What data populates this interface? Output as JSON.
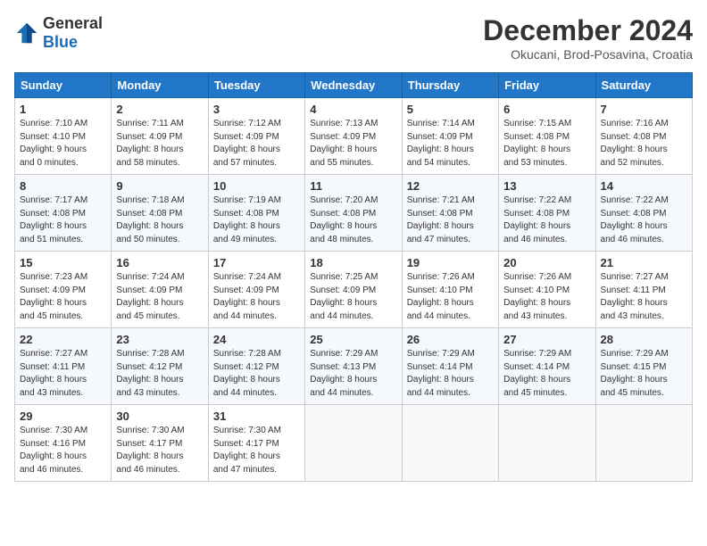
{
  "header": {
    "logo_general": "General",
    "logo_blue": "Blue",
    "month_title": "December 2024",
    "location": "Okucani, Brod-Posavina, Croatia"
  },
  "weekdays": [
    "Sunday",
    "Monday",
    "Tuesday",
    "Wednesday",
    "Thursday",
    "Friday",
    "Saturday"
  ],
  "weeks": [
    [
      {
        "day": "1",
        "sunrise": "Sunrise: 7:10 AM",
        "sunset": "Sunset: 4:10 PM",
        "daylight": "Daylight: 9 hours and 0 minutes."
      },
      {
        "day": "2",
        "sunrise": "Sunrise: 7:11 AM",
        "sunset": "Sunset: 4:09 PM",
        "daylight": "Daylight: 8 hours and 58 minutes."
      },
      {
        "day": "3",
        "sunrise": "Sunrise: 7:12 AM",
        "sunset": "Sunset: 4:09 PM",
        "daylight": "Daylight: 8 hours and 57 minutes."
      },
      {
        "day": "4",
        "sunrise": "Sunrise: 7:13 AM",
        "sunset": "Sunset: 4:09 PM",
        "daylight": "Daylight: 8 hours and 55 minutes."
      },
      {
        "day": "5",
        "sunrise": "Sunrise: 7:14 AM",
        "sunset": "Sunset: 4:09 PM",
        "daylight": "Daylight: 8 hours and 54 minutes."
      },
      {
        "day": "6",
        "sunrise": "Sunrise: 7:15 AM",
        "sunset": "Sunset: 4:08 PM",
        "daylight": "Daylight: 8 hours and 53 minutes."
      },
      {
        "day": "7",
        "sunrise": "Sunrise: 7:16 AM",
        "sunset": "Sunset: 4:08 PM",
        "daylight": "Daylight: 8 hours and 52 minutes."
      }
    ],
    [
      {
        "day": "8",
        "sunrise": "Sunrise: 7:17 AM",
        "sunset": "Sunset: 4:08 PM",
        "daylight": "Daylight: 8 hours and 51 minutes."
      },
      {
        "day": "9",
        "sunrise": "Sunrise: 7:18 AM",
        "sunset": "Sunset: 4:08 PM",
        "daylight": "Daylight: 8 hours and 50 minutes."
      },
      {
        "day": "10",
        "sunrise": "Sunrise: 7:19 AM",
        "sunset": "Sunset: 4:08 PM",
        "daylight": "Daylight: 8 hours and 49 minutes."
      },
      {
        "day": "11",
        "sunrise": "Sunrise: 7:20 AM",
        "sunset": "Sunset: 4:08 PM",
        "daylight": "Daylight: 8 hours and 48 minutes."
      },
      {
        "day": "12",
        "sunrise": "Sunrise: 7:21 AM",
        "sunset": "Sunset: 4:08 PM",
        "daylight": "Daylight: 8 hours and 47 minutes."
      },
      {
        "day": "13",
        "sunrise": "Sunrise: 7:22 AM",
        "sunset": "Sunset: 4:08 PM",
        "daylight": "Daylight: 8 hours and 46 minutes."
      },
      {
        "day": "14",
        "sunrise": "Sunrise: 7:22 AM",
        "sunset": "Sunset: 4:08 PM",
        "daylight": "Daylight: 8 hours and 46 minutes."
      }
    ],
    [
      {
        "day": "15",
        "sunrise": "Sunrise: 7:23 AM",
        "sunset": "Sunset: 4:09 PM",
        "daylight": "Daylight: 8 hours and 45 minutes."
      },
      {
        "day": "16",
        "sunrise": "Sunrise: 7:24 AM",
        "sunset": "Sunset: 4:09 PM",
        "daylight": "Daylight: 8 hours and 45 minutes."
      },
      {
        "day": "17",
        "sunrise": "Sunrise: 7:24 AM",
        "sunset": "Sunset: 4:09 PM",
        "daylight": "Daylight: 8 hours and 44 minutes."
      },
      {
        "day": "18",
        "sunrise": "Sunrise: 7:25 AM",
        "sunset": "Sunset: 4:09 PM",
        "daylight": "Daylight: 8 hours and 44 minutes."
      },
      {
        "day": "19",
        "sunrise": "Sunrise: 7:26 AM",
        "sunset": "Sunset: 4:10 PM",
        "daylight": "Daylight: 8 hours and 44 minutes."
      },
      {
        "day": "20",
        "sunrise": "Sunrise: 7:26 AM",
        "sunset": "Sunset: 4:10 PM",
        "daylight": "Daylight: 8 hours and 43 minutes."
      },
      {
        "day": "21",
        "sunrise": "Sunrise: 7:27 AM",
        "sunset": "Sunset: 4:11 PM",
        "daylight": "Daylight: 8 hours and 43 minutes."
      }
    ],
    [
      {
        "day": "22",
        "sunrise": "Sunrise: 7:27 AM",
        "sunset": "Sunset: 4:11 PM",
        "daylight": "Daylight: 8 hours and 43 minutes."
      },
      {
        "day": "23",
        "sunrise": "Sunrise: 7:28 AM",
        "sunset": "Sunset: 4:12 PM",
        "daylight": "Daylight: 8 hours and 43 minutes."
      },
      {
        "day": "24",
        "sunrise": "Sunrise: 7:28 AM",
        "sunset": "Sunset: 4:12 PM",
        "daylight": "Daylight: 8 hours and 44 minutes."
      },
      {
        "day": "25",
        "sunrise": "Sunrise: 7:29 AM",
        "sunset": "Sunset: 4:13 PM",
        "daylight": "Daylight: 8 hours and 44 minutes."
      },
      {
        "day": "26",
        "sunrise": "Sunrise: 7:29 AM",
        "sunset": "Sunset: 4:14 PM",
        "daylight": "Daylight: 8 hours and 44 minutes."
      },
      {
        "day": "27",
        "sunrise": "Sunrise: 7:29 AM",
        "sunset": "Sunset: 4:14 PM",
        "daylight": "Daylight: 8 hours and 45 minutes."
      },
      {
        "day": "28",
        "sunrise": "Sunrise: 7:29 AM",
        "sunset": "Sunset: 4:15 PM",
        "daylight": "Daylight: 8 hours and 45 minutes."
      }
    ],
    [
      {
        "day": "29",
        "sunrise": "Sunrise: 7:30 AM",
        "sunset": "Sunset: 4:16 PM",
        "daylight": "Daylight: 8 hours and 46 minutes."
      },
      {
        "day": "30",
        "sunrise": "Sunrise: 7:30 AM",
        "sunset": "Sunset: 4:17 PM",
        "daylight": "Daylight: 8 hours and 46 minutes."
      },
      {
        "day": "31",
        "sunrise": "Sunrise: 7:30 AM",
        "sunset": "Sunset: 4:17 PM",
        "daylight": "Daylight: 8 hours and 47 minutes."
      },
      null,
      null,
      null,
      null
    ]
  ]
}
